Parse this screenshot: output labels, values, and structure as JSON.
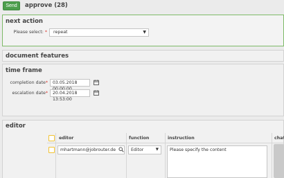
{
  "topbar": {
    "send_label": "Send",
    "title": "approve (28)"
  },
  "next_action": {
    "heading": "next action",
    "please_select_label": "Please select:",
    "please_select_value": "repeat"
  },
  "document_features": {
    "heading": "document features"
  },
  "time_frame": {
    "heading": "time frame",
    "completion_label": "completion date",
    "completion_value": "03.05.2018 00:00:00",
    "escalation_label": "escalation date",
    "escalation_value": "20.04.2018 13:53:00"
  },
  "editor_section": {
    "heading": "editor",
    "columns": {
      "editor": "editor",
      "function": "function",
      "instruction": "instruction",
      "chat": "chat"
    },
    "row": {
      "editor_value": "mhartmann@jobrouter.de",
      "function_value": "Editor",
      "instruction_value": "Please specify the content"
    }
  },
  "colors": {
    "accent_green": "#4d9e4d",
    "required_red": "#d9342b",
    "checkbox_yellow": "#f1c232"
  },
  "icons": [
    "calendar-icon",
    "search-icon",
    "chevron-down-icon"
  ]
}
